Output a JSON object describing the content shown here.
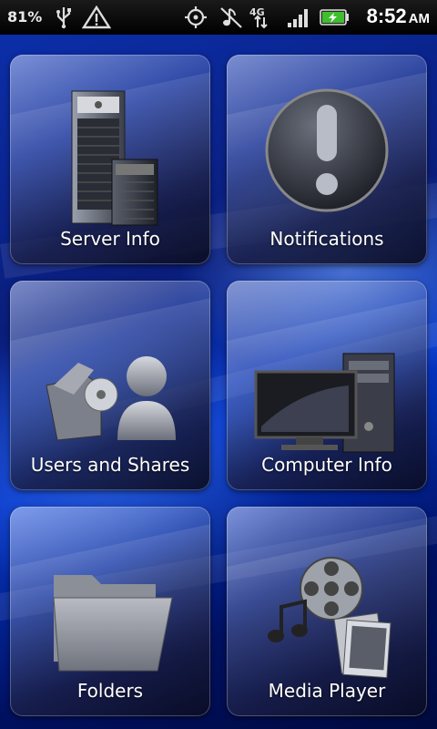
{
  "status_bar": {
    "battery_percent": "81%",
    "time": "8:52",
    "ampm": "AM",
    "network": "4G",
    "icons": [
      "usb-icon",
      "warning-icon",
      "gps-icon",
      "mute-icon",
      "4g-data-icon",
      "signal-icon",
      "battery-charging-icon"
    ]
  },
  "tiles": [
    {
      "label": "Server Info",
      "icon": "server-icon"
    },
    {
      "label": "Notifications",
      "icon": "exclamation-icon"
    },
    {
      "label": "Users and Shares",
      "icon": "users-shares-icon"
    },
    {
      "label": "Computer Info",
      "icon": "computer-icon"
    },
    {
      "label": "Folders",
      "icon": "folder-icon"
    },
    {
      "label": "Media Player",
      "icon": "media-player-icon"
    }
  ]
}
